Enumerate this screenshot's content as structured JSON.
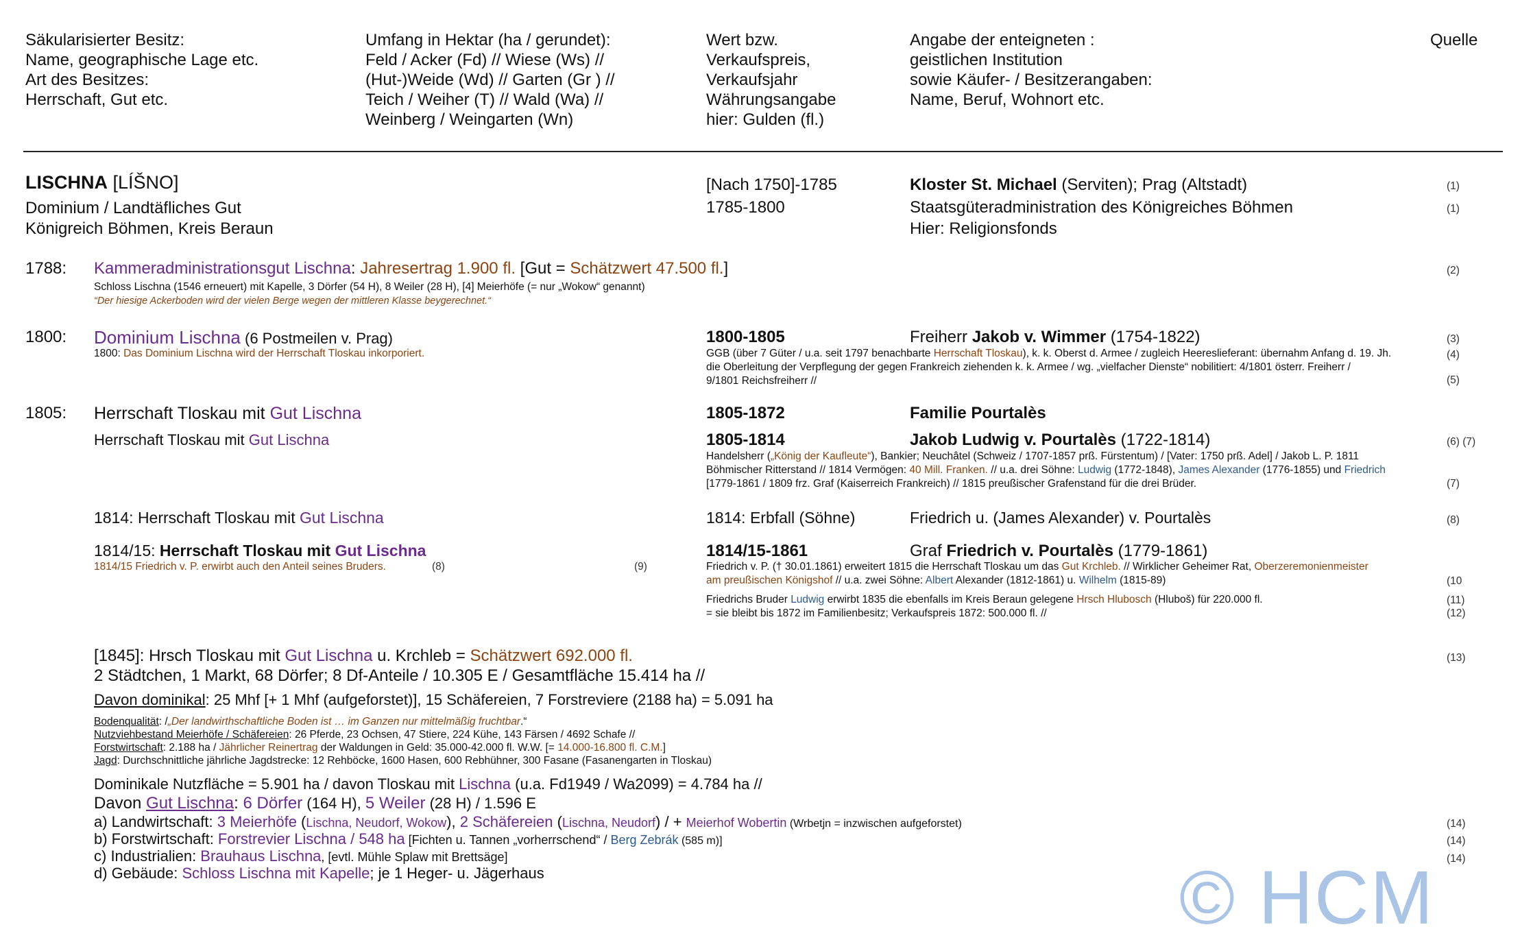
{
  "header": {
    "col1": [
      "Säkularisierter Besitz:",
      "Name, geographische Lage etc.",
      "Art des Besitzes:",
      "Herrschaft, Gut etc."
    ],
    "col2": [
      "Umfang in Hektar (ha / gerundet):",
      "Feld / Acker (Fd) // Wiese (Ws) //",
      "(Hut-)Weide (Wd) // Garten (Gr ) //",
      "Teich / Weiher (T) // Wald (Wa) //",
      "Weinberg / Weingarten (Wn)"
    ],
    "col3": [
      "Wert bzw.",
      "Verkaufspreis,",
      "Verkaufsjahr",
      "Währungsangabe",
      "hier: Gulden (fl.)"
    ],
    "col4": [
      "Angabe der enteigneten :",
      "geistlichen Institution",
      "sowie Käufer- / Besitzerangaben:",
      "Name, Beruf, Wohnort etc."
    ],
    "col5": "Quelle"
  },
  "title": {
    "name": "LISCHNA",
    "alt": " [LÍŠNO]",
    "line2": "Dominium / Landtäfliches Gut",
    "line3": "Königreich Böhmen, Kreis Beraun",
    "years1": "[Nach 1750]-1785",
    "years2": "1785-1800",
    "owner1_bold": "Kloster St. Michael",
    "owner1_rest": " (Serviten); Prag (Altstadt)",
    "owner2": "Staatsgüteradministration des Königreiches Böhmen",
    "owner3": "Hier: Religionsfonds",
    "src1": "(1)",
    "src2": "(1)"
  },
  "y1788": {
    "year": "1788:",
    "a": "Kammeradministrationsgut Lischna",
    "b": ": ",
    "c": "Jahresertrag 1.900 fl.",
    "d": " [Gut = ",
    "e": "Schätzwert 47.500 fl.",
    "f": "]",
    "line2": "Schloss Lischna (1546 erneuert) mit Kapelle, 3 Dörfer (54 H), 8 Weiler (28 H), [4] Meierhöfe (= nur „Wokow“ genannt)",
    "line3": "“Der hiesige Ackerboden wird der vielen Berge wegen der mittleren Klasse beygerechnet.“",
    "src": "(2)"
  },
  "y1800": {
    "year": "1800:",
    "a": "Dominium Lischna",
    "b": " (6 Postmeilen v. Prag)",
    "note_year": "1800: ",
    "note": "Das Dominium Lischna wird der Herrschaft Tloskau inkorporiert.",
    "years": "1800-1805",
    "owner_pre": "Freiherr ",
    "owner_bold": "Jakob v. Wimmer",
    "owner_rest": " (1754-1822)",
    "d1a": "GGB (über 7 Güter / u.a. seit 1797 benachbarte ",
    "d1b": "Herrschaft Tloskau",
    "d1c": "), k. k. Oberst d. Armee / zugleich Heereslieferant: übernahm Anfang d. 19. Jh.",
    "d2": "die Oberleitung der Verpflegung der gegen Frankreich ziehenden k. k. Armee / wg. „vielfacher Dienste“ nobilitiert: 4/1801 österr. Freiherr /",
    "d3": "9/1801 Reichsfreiherr //",
    "src1": "(3)",
    "src2": "(4)",
    "src3": "(5)"
  },
  "y1805": {
    "year": "1805:",
    "a": "Herrschaft Tloskau mit ",
    "b": "Gut Lischna",
    "line2a": "Herrschaft Tloskau mit ",
    "line2b": "Gut Lischna",
    "years": "1805-1872",
    "family": "Familie Pourtalès",
    "years2": "1805-1814",
    "owner_bold": "Jakob Ludwig v. Pourtalès",
    "owner_rest": " (1722-1814)",
    "d1a": "Handelsherr (",
    "d1b": "„König der Kaufleute“",
    "d1c": "), Bankier; Neuchâtel (Schweiz / 1707-1857 prß. Fürstentum) / [Vater: 1750 prß. Adel] / Jakob L. P. 1811",
    "d2a": "Böhmischer Ritterstand // 1814 Vermögen: ",
    "d2b": "40 Mill. Franken.",
    "d2c": " // u.a. drei Söhne: ",
    "d2d": "Ludwig",
    "d2e": " (1772-1848), ",
    "d2f": "James Alexander",
    "d2g": " (1776-1855) und ",
    "d2h": "Friedrich",
    "d3": "[1779-1861 / 1809 frz. Graf (Kaiserreich Frankreich) // 1815 preußischer Grafenstand für die drei Brüder.",
    "src1": "(6) (7)",
    "src2": "(7)"
  },
  "y1814": {
    "left_a": "1814: Herrschaft Tloskau mit ",
    "left_b": "Gut Lischna",
    "right_a": "1814: Erbfall (Söhne)",
    "right_b": "Friedrich u. (James Alexander) v. Pourtalès",
    "src": "(8)"
  },
  "y1814_15": {
    "left_pre": "1814/15: ",
    "left_bold": "Herrschaft Tloskau mit ",
    "left_bold_p": "Gut Lischna",
    "note": "1814/15 Friedrich v. P. erwirbt auch den Anteil seines Bruders.",
    "note_src": "(8)",
    "note_src2": "(9)",
    "years": "1814/15-1861",
    "owner_pre": "Graf ",
    "owner_bold": "Friedrich v. Pourtalès",
    "owner_rest": " (1779-1861)",
    "d1a": "Friedrich v. P. († 30.01.1861) erweitert 1815 die Herrschaft Tloskau um das ",
    "d1b": "Gut Krchleb.",
    "d1c": " // Wirklicher Geheimer Rat, ",
    "d1d": "Oberzeremonienmeister",
    "d2a": "am preußischen Königshof",
    "d2b": " // u.a. zwei Söhne: ",
    "d2c": "Albert",
    "d2d": " Alexander (1812-1861) u. ",
    "d2e": "Wilhelm",
    "d2f": " (1815-89)",
    "d3a": "Friedrichs Bruder ",
    "d3b": "Ludwig",
    "d3c": " erwirbt 1835 die ebenfalls im Kreis Beraun gelegene ",
    "d3d": "Hrsch Hlubosch",
    "d3e": " (Hluboš) für 220.000 fl.",
    "d4": "= sie bleibt bis 1872 im Familienbesitz; Verkaufspreis 1872: 500.000 fl. //",
    "src1": "(10",
    "src2": "(11)",
    "src3": "(12)"
  },
  "y1845": {
    "l1a": "[1845]: Hrsch Tloskau mit ",
    "l1b": "Gut Lischna",
    "l1c": " u. Krchleb = ",
    "l1d": "Schätzwert 692.000 fl.",
    "l2": "2 Städtchen, 1 Markt, 68 Dörfer; 8 Df-Anteile / 10.305 E / Gesamtfläche 15.414 ha //",
    "l3a": "Davon dominikal",
    "l3b": ": 25 Mhf [+ 1 Mhf (aufgeforstet)], 15 Schäfereien, 7 Forstreviere (2188 ha) = 5.091 ha",
    "s1a": "Bodenqualität",
    "s1b": ": /",
    "s1c": "„Der landwirthschaftliche Boden ist … im Ganzen nur mittelmäßig fruchtbar",
    "s1d": ".“",
    "s2a": "Nutzviehbestand Meierhöfe / Schäfereien",
    "s2b": ": 26 Pferde, 23 Ochsen, 47 Stiere, 224 Kühe, 143 Färsen / 4692 Schafe //",
    "s3a": "Forstwirtschaft",
    "s3b": ": 2.188 ha / ",
    "s3c": "Jährlicher Reinertrag",
    "s3d": " der Waldungen in Geld: 35.000-42.000 fl. W.W. [= ",
    "s3e": "14.000-16.800 fl. C.M.",
    "s3f": "]",
    "s4a": "Jagd",
    "s4b": ": Durchschnittliche jährliche Jagdstrecke: 12 Rehböcke, 1600 Hasen, 600 Rebhühner, 300 Fasane (Fasanengarten in Tloskau)",
    "l5a": "Dominikale Nutzfläche = 5.901 ha / davon Tloskau mit ",
    "l5b": "Lischna",
    "l5c": " (u.a. Fd1949 / Wa2099) = 4.784 ha //",
    "l6a": "Davon ",
    "l6b": "Gut Lischna",
    "l6c": ": ",
    "l6d": "6 Dörfer",
    "l6e": " (164 H), ",
    "l6f": "5 Weiler",
    "l6g": " (28 H) / 1.596 E",
    "a1": "a) Landwirtschaft: ",
    "a2": "3 Meierhöfe",
    "a3": " (",
    "a4": "Lischna, Neudorf, Wokow",
    "a5": "), ",
    "a6": "2 Schäfereien",
    "a7": " (",
    "a8": "Lischna, Neudorf",
    "a9": ") / + ",
    "a10": "Meierhof Wobertin",
    "a11": " (Wrbetjn = inzwischen aufgeforstet)",
    "b1": "b) Forstwirtschaft: ",
    "b2": "Forstrevier Lischna / 548 ha",
    "b3": " [Fichten u. Tannen „vorherrschend“ / ",
    "b4": "Berg Zebrák",
    "b5": " (585 m)]",
    "c1": "c) Industrialien: ",
    "c2": "Brauhaus Lischna",
    "c3": ", [evtl. Mühle Splaw mit Brettsäge]",
    "d1": "d) Gebäude: ",
    "d2": "Schloss Lischna mit Kapelle",
    "d3": "; je 1 Heger- u. Jägerhaus",
    "src1": "(13)",
    "src2": "(14)",
    "src3": "(14)",
    "src4": "(14)"
  },
  "watermark": "© HCM"
}
